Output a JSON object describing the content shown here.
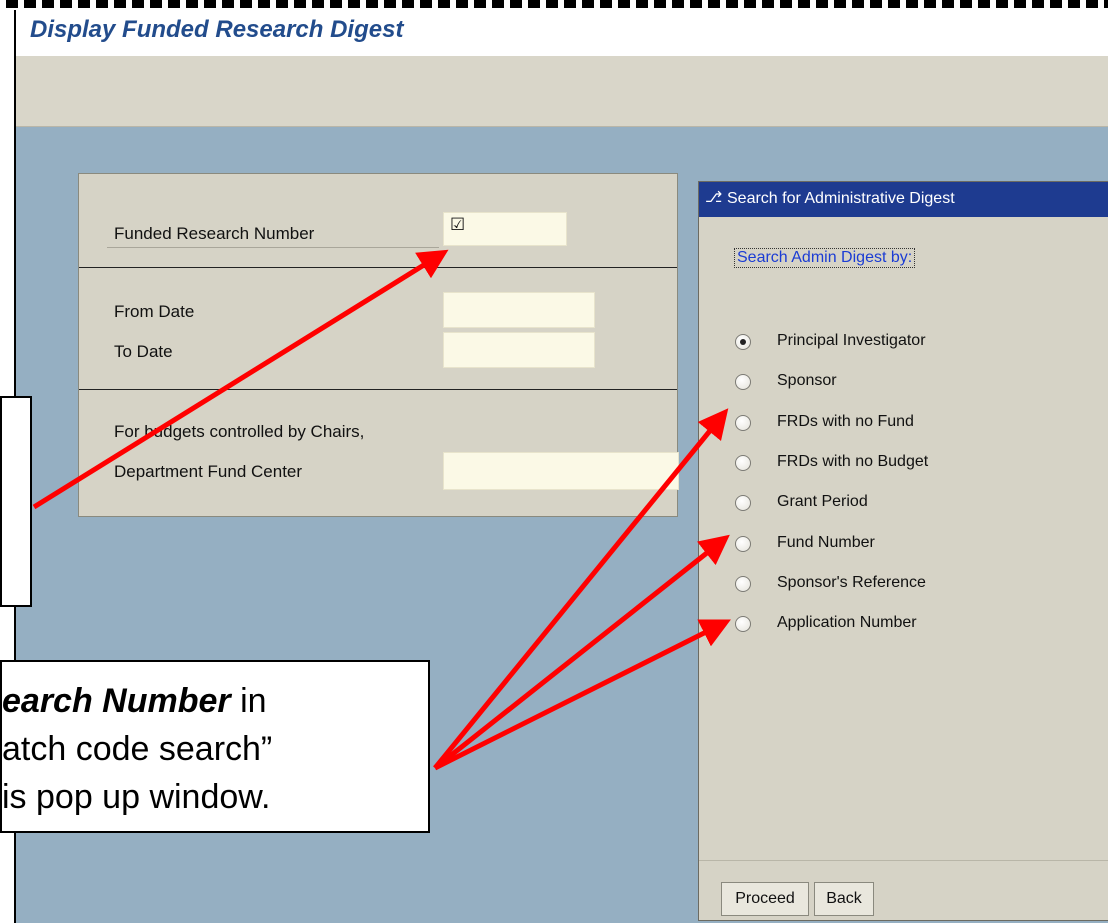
{
  "window": {
    "title": "Display Funded Research Digest"
  },
  "selection": {
    "frn_label": "Funded Research Number",
    "frn_value": "☑",
    "from_date_label": "From Date",
    "from_date_value": "",
    "to_date_label": "To Date",
    "to_date_value": "",
    "budget_note": "For budgets controlled by Chairs,",
    "dept_fund_center_label": "Department Fund Center",
    "dept_fund_center_value": ""
  },
  "popup": {
    "title": "Search for Administrative Digest",
    "title_icon": "window-icon",
    "group_label": "Search Admin Digest by:",
    "options": [
      {
        "label": "Principal Investigator",
        "selected": true
      },
      {
        "label": "Sponsor",
        "selected": false
      },
      {
        "label": "FRDs with no Fund",
        "selected": false
      },
      {
        "label": "FRDs with no Budget",
        "selected": false
      },
      {
        "label": "Grant Period",
        "selected": false
      },
      {
        "label": "Fund Number",
        "selected": false
      },
      {
        "label": "Sponsor's Reference",
        "selected": false
      },
      {
        "label": "Application Number",
        "selected": false
      }
    ],
    "proceed_label": "Proceed",
    "back_label": "Back"
  },
  "callout": {
    "bold_part": "earch Number",
    "line1_rest": " in",
    "line2": "atch code search”",
    "line3": "is pop up window."
  },
  "colors": {
    "background": "#95afc2",
    "title_text": "#224c8c",
    "popup_title_bar": "#1e3b90",
    "arrow": "#ff0000"
  }
}
